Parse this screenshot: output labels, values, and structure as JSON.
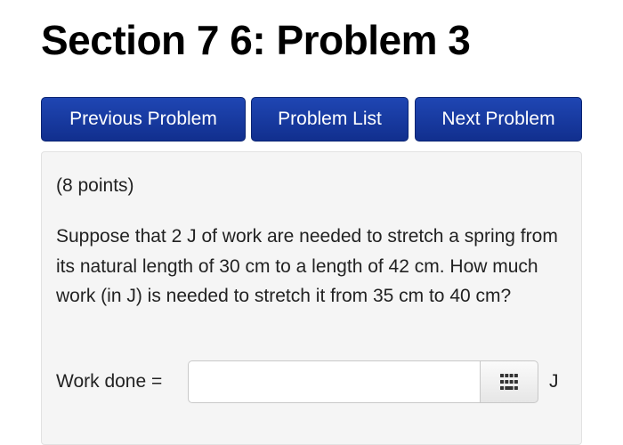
{
  "page": {
    "title": "Section 7 6: Problem 3"
  },
  "nav": {
    "previous_label": "Previous Problem",
    "list_label": "Problem List",
    "next_label": "Next Problem"
  },
  "problem": {
    "points": "(8 points)",
    "text": "Suppose that 2 J of work are needed to stretch a spring from its natural length of 30 cm to a length of 42 cm. How much work (in J) is needed to stretch it from 35 cm to 40 cm?",
    "answer": {
      "label": "Work done =",
      "value": "",
      "unit": "J",
      "keypad_icon": "keypad-grid-icon"
    }
  },
  "colors": {
    "button_bg": "#1a3ea8",
    "button_border": "#0a2472",
    "panel_bg": "#f5f5f5"
  }
}
